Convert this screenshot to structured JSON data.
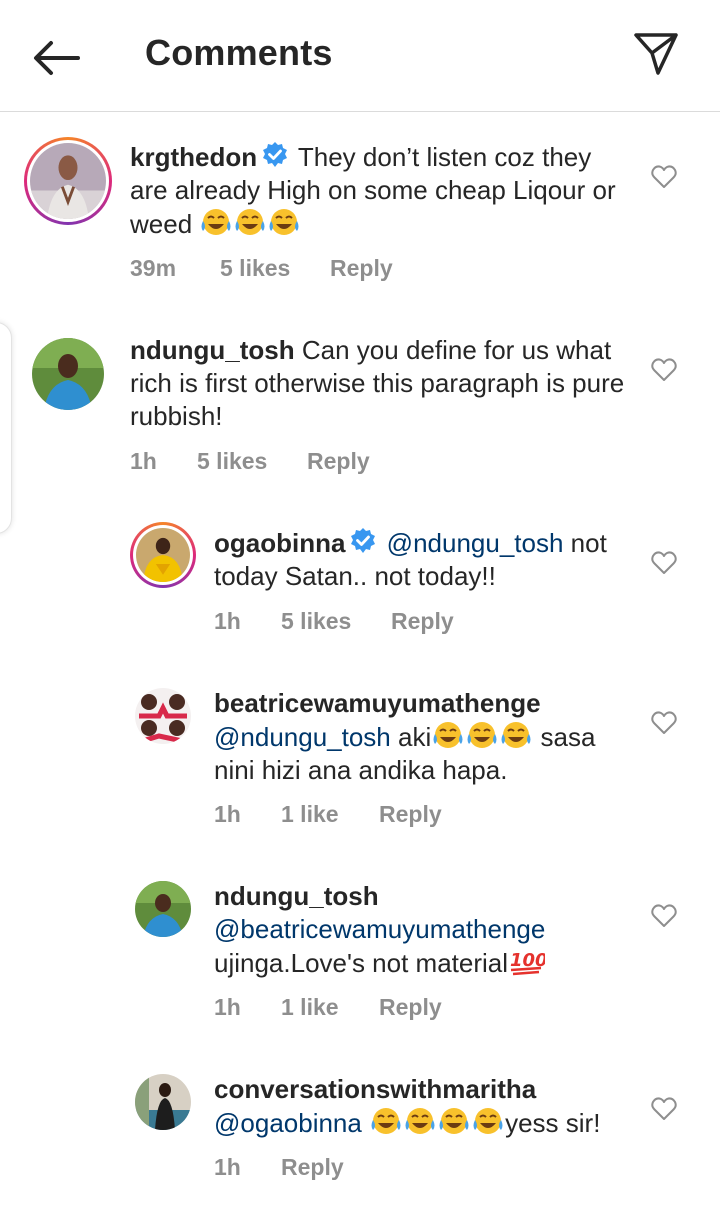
{
  "header": {
    "title": "Comments",
    "back_icon": "arrow-left-icon",
    "share_icon": "paper-plane-icon"
  },
  "colors": {
    "text": "#262626",
    "meta": "#8e8e8e",
    "mention": "#00376b",
    "verified": "#3897f0",
    "divider": "#dbdbdb"
  },
  "comments": [
    {
      "username": "krgthedon",
      "verified": true,
      "text": "They don’t listen coz they are already High on some cheap Liqour or weed",
      "emoji_count": 3,
      "time": "39m",
      "likes": "5 likes",
      "reply": "Reply"
    },
    {
      "username": "ndungu_tosh",
      "verified": false,
      "text": "Can you define for us what rich is first otherwise this paragraph is pure rubbish!",
      "time": "1h",
      "likes": "5 likes",
      "reply": "Reply"
    }
  ],
  "replies": [
    {
      "username": "ogaobinna",
      "verified": true,
      "mention": "@ndungu_tosh",
      "text": "not today Satan.. not today!!",
      "time": "1h",
      "likes": "5 likes",
      "reply": "Reply"
    },
    {
      "username": "beatricewamuyumathenge",
      "mention": "@ndungu_tosh",
      "text_a": "aki",
      "emoji_count": 3,
      "text_b": "sasa nini hizi ana andika hapa.",
      "time": "1h",
      "likes": "1 like",
      "reply": "Reply"
    },
    {
      "username": "ndungu_tosh",
      "mention": "@beatricewamuyumathenge",
      "text": "ujinga.Love's not material",
      "emoji": "hundred-points-icon",
      "time": "1h",
      "likes": "1 like",
      "reply": "Reply"
    },
    {
      "username": "conversationswithmaritha",
      "mention": "@ogaobinna",
      "emoji_count": 4,
      "text": "yess sir!",
      "time": "1h",
      "reply": "Reply"
    }
  ]
}
